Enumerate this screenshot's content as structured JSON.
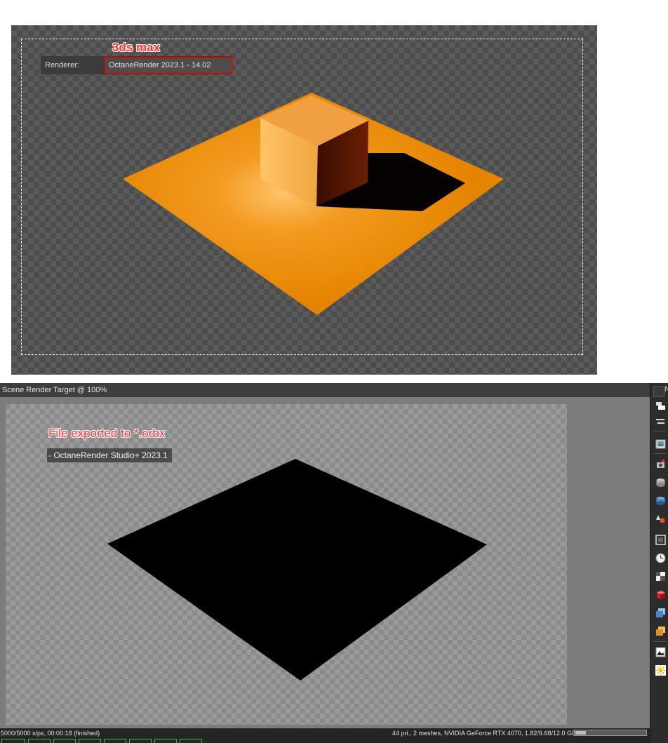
{
  "top_panel": {
    "annotation": "3ds max",
    "renderer_label": "Renderer:",
    "renderer_value": "OctaneRender 2023.1 - 14.02"
  },
  "bottom_panel": {
    "title": "Scene Render Target @ 100%",
    "annotation": "File exported to *.orbx",
    "studio_label": "- OctaneRender Studio+ 2023.1",
    "toolbar_header": "N",
    "status_left": "5000/5000 s/px, 00:00:18 (finished)",
    "status_right": "44 pri., 2 meshes, NVIDIA GeForce RTX 4070, 1.82/9.68/12.0 GB",
    "vram_usage_fraction": 0.15,
    "render_pass_buttons": [
      "",
      "",
      "",
      "",
      "",
      "",
      "",
      ""
    ],
    "toolbar_icons": [
      "layers-icon",
      "list-icon",
      "image-icon",
      "camera-icon",
      "film-stack-icon",
      "film-stack-blue-icon",
      "color-drops-icon",
      "frame-icon",
      "clock-icon",
      "texture-grid-icon",
      "red-cube-icon",
      "blue-cubes-icon",
      "orange-cubes-icon",
      "picture-icon",
      "sun-icon"
    ]
  },
  "colors": {
    "annotation_red": "#ff2a2a",
    "highlight_border": "#cc1010",
    "floor_orange": "#ea8b00",
    "status_green": "#3cb84a"
  }
}
